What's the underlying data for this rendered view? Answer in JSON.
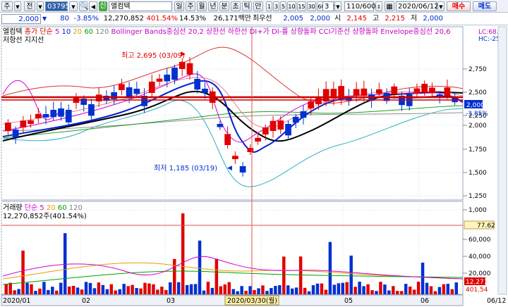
{
  "toolbar1": {
    "type_label": "주",
    "mode_label": "전",
    "code": "037950",
    "badge": "신",
    "stock_name": "엘컴텍",
    "periods": [
      "주",
      "월",
      "년",
      "분",
      "초",
      "틱",
      "만"
    ],
    "intervals": [
      "1",
      "3",
      "5",
      "10",
      "15",
      "30",
      "60",
      "120"
    ],
    "count": "3",
    "pages": "110/600",
    "date": "2020/06/12",
    "buy_label": "매수",
    "sell_label": "매도"
  },
  "toolbar2": {
    "price": "2,000",
    "change": "80",
    "change_rate": "-3.85%",
    "volume": "12,270,852",
    "volume_rate": "401.54%",
    "turnover": "14.53%",
    "amount": "26,171백만",
    "prev_label": "최우선",
    "prev_value": "2,005",
    "best_value": "2,000",
    "open_label": "시",
    "open_value": "2,145",
    "high_label": "고",
    "high_value": "2,215",
    "low_label": "저",
    "low_value": "2,000"
  },
  "price_panel": {
    "legend": [
      {
        "text": "엘컴텍",
        "color": "#000000"
      },
      {
        "text": "종가 단순",
        "color": "#d00000"
      },
      {
        "text": "5",
        "color": "#d000d0"
      },
      {
        "text": "10",
        "color": "#0020d0"
      },
      {
        "text": "20",
        "color": "#e0a000"
      },
      {
        "text": "60",
        "color": "#00a000"
      },
      {
        "text": "120",
        "color": "#808080"
      },
      {
        "text": "Bollinger Bands중심선 20,2",
        "color": "#c000c0"
      },
      {
        "text": "상한선",
        "color": "#c000c0"
      },
      {
        "text": "하한선",
        "color": "#c000c0"
      },
      {
        "text": "DI+가 DI-를 상향돌파",
        "color": "#c000c0"
      },
      {
        "text": "CCI기준선 상향돌파",
        "color": "#c000c0"
      },
      {
        "text": "Envelope중심선 20,6",
        "color": "#c000c0"
      }
    ],
    "sub_legend": "저항선 지지선",
    "annot_high": "최고 2,695 (03/09)",
    "annot_low": "최저 1,185 (03/19)",
    "right_top1": "LC:68.7",
    "right_top2": "HC:-25.",
    "current_price": "2,000",
    "current_rate": "-3.85%",
    "y_ticks": [
      "2,750",
      "2,500",
      "2,250",
      "2,000",
      "1,750",
      "1,500",
      "1,250",
      "1,000"
    ]
  },
  "volume_panel": {
    "legend": [
      {
        "text": "거래량",
        "color": "#000000"
      },
      {
        "text": "단순",
        "color": "#d000d0"
      },
      {
        "text": "5",
        "color": "#d000d0"
      },
      {
        "text": "20",
        "color": "#e0a000"
      },
      {
        "text": "60",
        "color": "#00a000"
      },
      {
        "text": "120",
        "color": "#808080"
      }
    ],
    "value_line": "12,270,852주(401.54%)",
    "y_ticks": [
      "77.62",
      "60,000",
      "40,000",
      "20,000"
    ],
    "right_badge1": "12,271",
    "right_badge2": "401.54"
  },
  "x_axis": {
    "labels": [
      "2020/01",
      "02",
      "03",
      "04",
      "05",
      "06",
      "06/12"
    ],
    "cursor_label": "2020/03/30(월)"
  },
  "colors": {
    "up": "#e00000",
    "down": "#0030d0",
    "highlight": "#d00000"
  }
}
